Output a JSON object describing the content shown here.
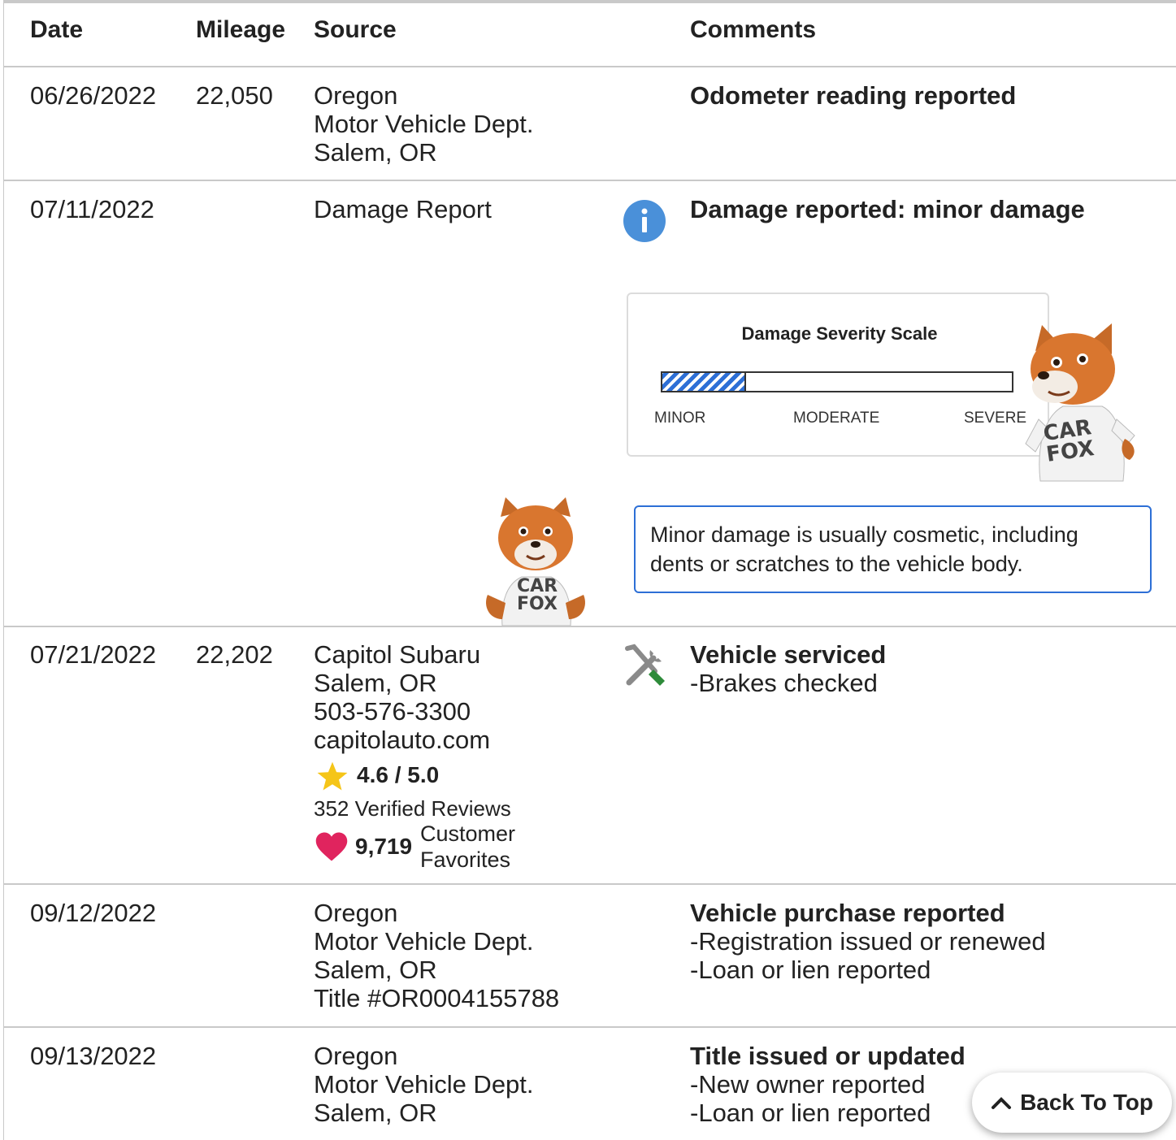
{
  "headers": {
    "date": "Date",
    "mileage": "Mileage",
    "source": "Source",
    "comments": "Comments"
  },
  "rows": [
    {
      "date": "06/26/2022",
      "mileage": "22,050",
      "source": [
        "Oregon",
        "Motor Vehicle Dept.",
        "Salem, OR"
      ],
      "comment_title": "Odometer reading reported"
    },
    {
      "date": "07/11/2022",
      "mileage": "",
      "source": [
        "Damage Report"
      ],
      "comment_title": "Damage reported: minor damage",
      "icon": "info-icon",
      "severity": {
        "title": "Damage Severity Scale",
        "labels": [
          "MINOR",
          "MODERATE",
          "SEVERE"
        ],
        "level_fraction": 0.24
      },
      "note": "Minor damage is usually cosmetic, including dents or scratches to the vehicle body."
    },
    {
      "date": "07/21/2022",
      "mileage": "22,202",
      "source": [
        "Capitol Subaru",
        "Salem, OR",
        "503-576-3300",
        "capitolauto.com"
      ],
      "rating": "4.6 / 5.0",
      "reviews": "352 Verified Reviews",
      "favorites_count": "9,719",
      "favorites_label": [
        "Customer",
        "Favorites"
      ],
      "icon": "wrench-screwdriver-icon",
      "comment_title": "Vehicle serviced",
      "comment_items": [
        "Brakes checked"
      ]
    },
    {
      "date": "09/12/2022",
      "mileage": "",
      "source": [
        "Oregon",
        "Motor Vehicle Dept.",
        "Salem, OR",
        "Title #OR0004155788"
      ],
      "comment_title": "Vehicle purchase reported",
      "comment_items": [
        "Registration issued or renewed",
        "Loan or lien reported"
      ]
    },
    {
      "date": "09/13/2022",
      "mileage": "",
      "source": [
        "Oregon",
        "Motor Vehicle Dept.",
        "Salem, OR"
      ],
      "comment_title": "Title issued or updated",
      "comment_items": [
        "New owner reported",
        "Loan or lien reported"
      ]
    }
  ],
  "mascot_text": [
    "CAR",
    "FOX"
  ],
  "back_to_top": "Back To Top",
  "colors": {
    "accent": "#2d6fd6",
    "info": "#4a90d9",
    "star": "#f5c518",
    "heart": "#e0245e",
    "divider": "#c9c9c9"
  }
}
